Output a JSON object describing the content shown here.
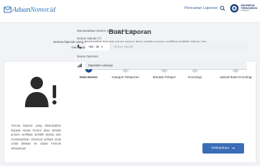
{
  "header": {
    "logo": {
      "part1": "Aduan",
      "part2": "Nomor",
      "part3": ".id"
    },
    "lapor_link": "Pencarian Laporan",
    "ministry": {
      "line1": "INDONESIA",
      "line2": "TERKONEKSI",
      "sub": "KOMINFO"
    }
  },
  "intro": {
    "title": "Buat Laporan",
    "desc_line1": "Semua laporan yang disampaikan kepada Aduan Nomor akan melalui proses verifikasi terlebih dahulu dan",
    "desc_line2": "membutuhkan informasi pribadi Anda untuk diisikan ke dalam formulir selanjutnya"
  },
  "left": {
    "desc": "Semua laporan yang disampaikan kepada Aduan Nomor akan melalui proses verifikasi terlebih dahulu dan membutuhkan informasi pribadi anda untuk diisikan ke dalam formulir selanjutnya"
  },
  "steps": [
    {
      "num": "1",
      "label": "Data Nomor",
      "active": true
    },
    {
      "num": "2",
      "label": "Kategori Pelaporan",
      "active": false
    },
    {
      "num": "3",
      "label": "Biodata Pelapor",
      "active": false
    },
    {
      "num": "4",
      "label": "Kronologi",
      "active": false
    },
    {
      "num": "5",
      "label": "Upload Bukti Kronologi",
      "active": false
    }
  ],
  "form": {
    "hint": "Memasukkan Nomor yang ingin dilaporkan",
    "phone_label": "Nomor Seluler (*)",
    "country_code": "+62 - ID",
    "phone_placeholder": "Nomor Seluler",
    "operator_label": "Nama Operator",
    "operator_value": "Operator Lainnya"
  },
  "next_button": "Selanjutnya",
  "colors": {
    "primary": "#1f4e96",
    "button": "#3a6cb8",
    "bg": "#f1f3f6"
  }
}
